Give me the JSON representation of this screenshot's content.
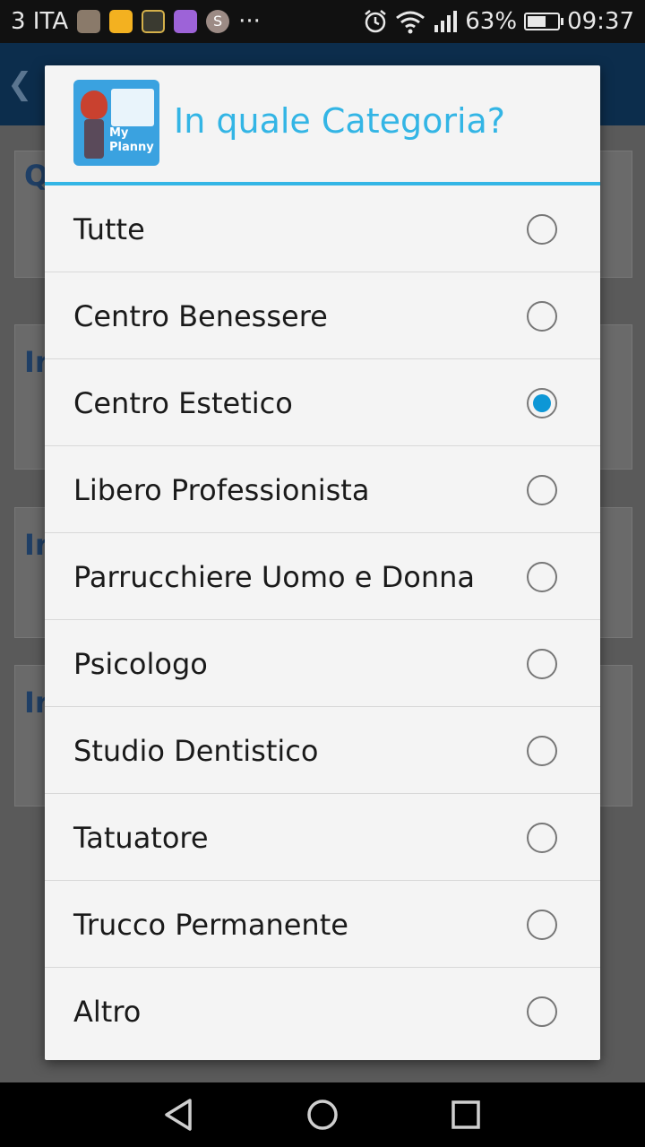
{
  "status_bar": {
    "carrier": "3 ITA",
    "more": "···",
    "avatar_letter": "S",
    "battery_percent": "63%",
    "battery_level": 0.63,
    "time": "09:37",
    "icons": [
      "photo-app-icon",
      "yellow-app-icon",
      "wallet-app-icon",
      "gallery-app-icon",
      "avatar-icon",
      "alarm-icon",
      "wifi-icon",
      "signal-icon",
      "battery-icon"
    ]
  },
  "background": {
    "back_glyph": "❮",
    "letters": [
      "Q",
      "In",
      "In",
      "In"
    ]
  },
  "dialog": {
    "title": "In quale Categoria?",
    "logo_text_1": "My",
    "logo_text_2": "Planny",
    "accent_color": "#33b5e5",
    "selected_index": 2,
    "options": [
      {
        "label": "Tutte",
        "checked": false
      },
      {
        "label": "Centro Benessere",
        "checked": false
      },
      {
        "label": "Centro Estetico",
        "checked": true
      },
      {
        "label": "Libero Professionista",
        "checked": false
      },
      {
        "label": "Parrucchiere Uomo e Donna",
        "checked": false
      },
      {
        "label": "Psicologo",
        "checked": false
      },
      {
        "label": "Studio Dentistico",
        "checked": false
      },
      {
        "label": "Tatuatore",
        "checked": false
      },
      {
        "label": "Trucco Permanente",
        "checked": false
      },
      {
        "label": "Altro",
        "checked": false
      }
    ]
  },
  "nav_bar": {
    "icons": [
      "back-triangle-icon",
      "home-circle-icon",
      "recents-square-icon"
    ]
  }
}
